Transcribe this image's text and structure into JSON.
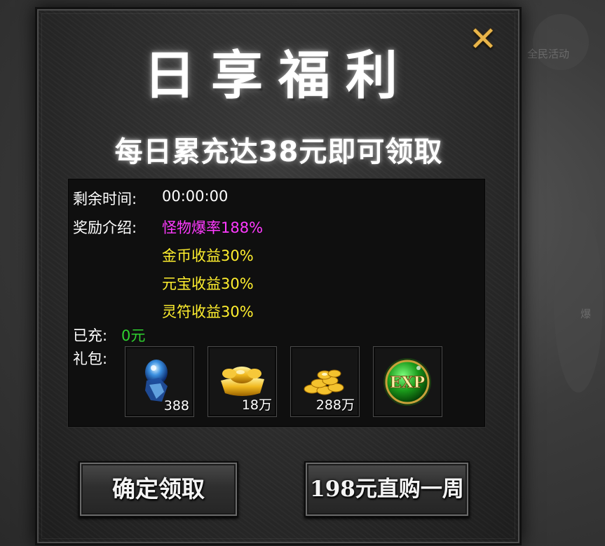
{
  "background": {
    "hint_top": "全民活动",
    "hint_side": "爆"
  },
  "dialog": {
    "close_icon": "close-x-icon",
    "title": "日享福利",
    "subtitle": "每日累充达38元即可领取",
    "remaining_label": "剩余时间:",
    "remaining_value": "00:00:00",
    "reward_label": "奖励介绍:",
    "rewards": [
      "怪物爆率188%",
      "金币收益30%",
      "元宝收益30%",
      "灵符收益30%"
    ],
    "charged_label": "已充:",
    "charged_value": "0元",
    "gift_label": "礼包:",
    "items": [
      {
        "icon": "blue-gem-icon",
        "qty": "388"
      },
      {
        "icon": "gold-ingot-icon",
        "qty": "18万"
      },
      {
        "icon": "gold-coins-icon",
        "qty": "288万"
      },
      {
        "icon": "exp-orb-icon",
        "qty": ""
      }
    ],
    "confirm_label": "确定领取",
    "buy_label": "198元直购一周"
  },
  "colors": {
    "accent_close": "#e9b54a",
    "magenta": "#ff3aff",
    "yellow": "#ffef2e",
    "green": "#2fd12f"
  }
}
